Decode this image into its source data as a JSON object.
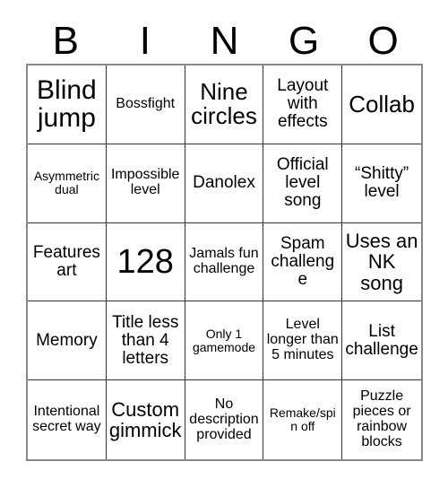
{
  "card": {
    "header_letters": [
      "B",
      "I",
      "N",
      "G",
      "O"
    ],
    "colors": {
      "background": "#ffffff",
      "text": "#000000",
      "cell_border": "#333333",
      "outer_border": "#888888"
    },
    "rows": [
      [
        {
          "text": "Blind jump",
          "size": "fs-xxl"
        },
        {
          "text": "Bossfight",
          "size": "fs-sm"
        },
        {
          "text": "Nine circles",
          "size": "fs-xl"
        },
        {
          "text": "Layout with effects",
          "size": "fs-md"
        },
        {
          "text": "Collab",
          "size": "fs-xl"
        }
      ],
      [
        {
          "text": "Asymmetric dual",
          "size": "fs-xs"
        },
        {
          "text": "Impossible level",
          "size": "fs-sm"
        },
        {
          "text": "Danolex",
          "size": "fs-md"
        },
        {
          "text": "Official level song",
          "size": "fs-md"
        },
        {
          "text": "“Shitty” level",
          "size": "fs-md"
        }
      ],
      [
        {
          "text": "Features art",
          "size": "fs-md"
        },
        {
          "text": "128",
          "size": "fs-num"
        },
        {
          "text": "Jamals fun challenge",
          "size": "fs-sm"
        },
        {
          "text": "Spam challenge",
          "size": "fs-md"
        },
        {
          "text": "Uses an NK song",
          "size": "fs-lg"
        }
      ],
      [
        {
          "text": "Memory",
          "size": "fs-md"
        },
        {
          "text": "Title less than 4 letters",
          "size": "fs-md"
        },
        {
          "text": "Only 1 gamemode",
          "size": "fs-xs"
        },
        {
          "text": "Level longer than 5 minutes",
          "size": "fs-sm"
        },
        {
          "text": "List challenge",
          "size": "fs-md"
        }
      ],
      [
        {
          "text": "Intentional secret way",
          "size": "fs-sm"
        },
        {
          "text": "Custom gimmick",
          "size": "fs-lg"
        },
        {
          "text": "No description provided",
          "size": "fs-sm"
        },
        {
          "text": "Remake/spin off",
          "size": "fs-xs"
        },
        {
          "text": "Puzzle pieces or rainbow blocks",
          "size": "fs-sm"
        }
      ]
    ]
  }
}
